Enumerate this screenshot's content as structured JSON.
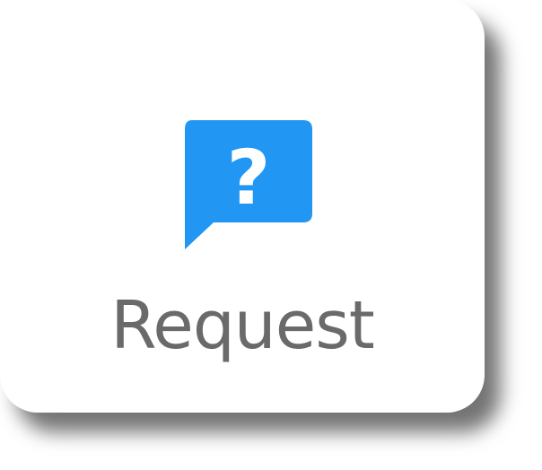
{
  "button": {
    "label": "Request",
    "icon": "question-speech-bubble-icon",
    "icon_glyph": "?",
    "colors": {
      "icon_fill": "#2196F3",
      "icon_glyph": "#FFFFFF",
      "label": "#6A6A6A",
      "background": "#FFFFFF"
    }
  }
}
